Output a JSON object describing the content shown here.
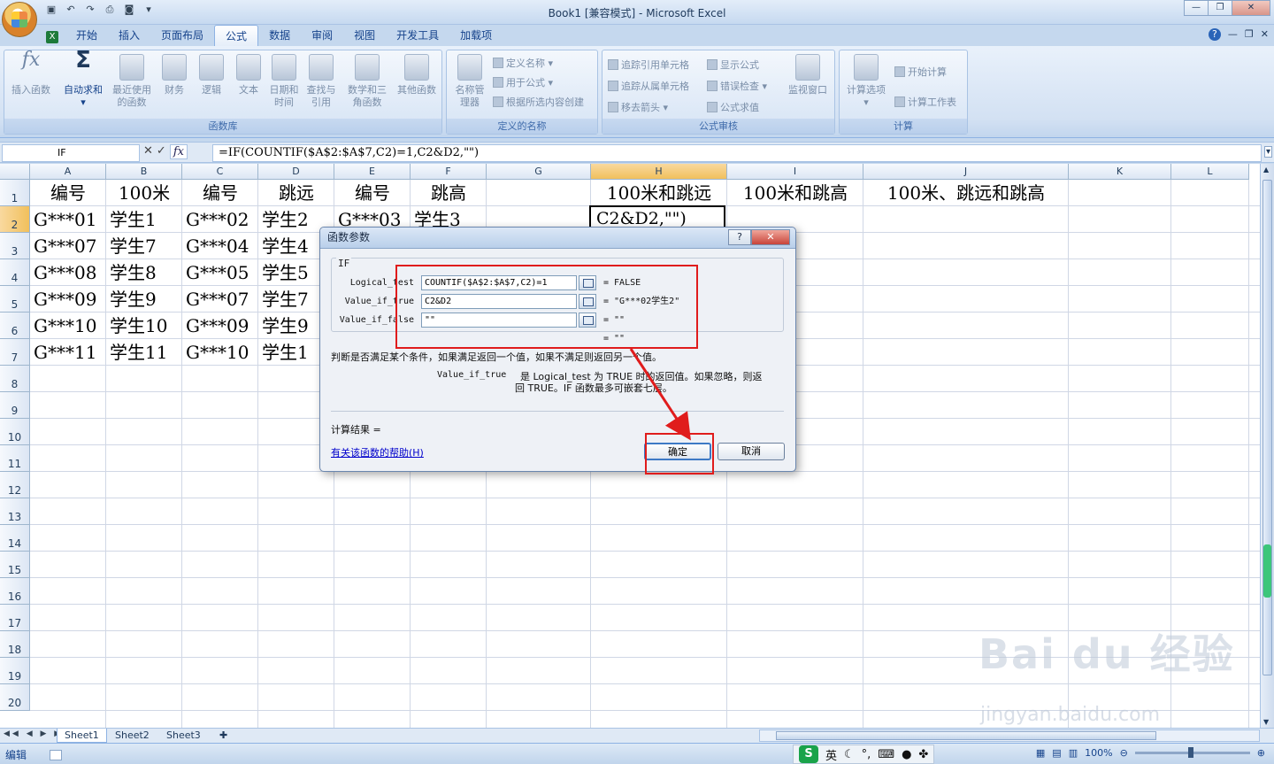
{
  "window": {
    "title": "Book1  [兼容模式] - Microsoft Excel"
  },
  "tabs": [
    "开始",
    "插入",
    "页面布局",
    "公式",
    "数据",
    "审阅",
    "视图",
    "开发工具",
    "加载项"
  ],
  "active_tab": "公式",
  "ribbon": {
    "groups": {
      "library": "函数库",
      "names": "定义的名称",
      "audit": "公式审核",
      "calc": "计算"
    },
    "buttons": {
      "insert_function": "插入函数",
      "autosum": "自动求和",
      "recent": "最近使用的函数",
      "financial": "财务",
      "logical": "逻辑",
      "text": "文本",
      "datetime": "日期和时间",
      "lookup": "查找与引用",
      "math": "数学和三角函数",
      "more": "其他函数",
      "name_manager": "名称管理器",
      "define_name": "定义名称",
      "use_in_formula": "用于公式",
      "create_from_selection": "根据所选内容创建",
      "trace_precedents": "追踪引用单元格",
      "trace_dependents": "追踪从属单元格",
      "remove_arrows": "移去箭头",
      "show_formulas": "显示公式",
      "error_checking": "错误检查",
      "evaluate_formula": "公式求值",
      "watch_window": "监视窗口",
      "calc_options": "计算选项",
      "calc_now": "开始计算",
      "calc_sheet": "计算工作表"
    }
  },
  "formula_bar": {
    "name_box": "IF",
    "formula": "=IF(COUNTIF($A$2:$A$7,C2)=1,C2&D2,\"\")"
  },
  "columns": [
    "A",
    "B",
    "C",
    "D",
    "E",
    "F",
    "G",
    "H",
    "I",
    "J",
    "K",
    "L"
  ],
  "selected_column": "H",
  "rows": [
    "1",
    "2",
    "3",
    "4",
    "5",
    "6",
    "7",
    "8",
    "9",
    "10",
    "11",
    "12",
    "13",
    "14",
    "15",
    "16",
    "17",
    "18",
    "19",
    "20"
  ],
  "selected_row": "2",
  "cells": {
    "header": [
      "编号",
      "100米",
      "编号",
      "跳远",
      "编号",
      "跳高",
      "",
      "100米和跳远",
      "100米和跳高",
      "100米、跳远和跳高"
    ],
    "data": [
      [
        "G***01",
        "学生1",
        "G***02",
        "学生2",
        "G***03",
        "学生3"
      ],
      [
        "G***07",
        "学生7",
        "G***04",
        "学生4",
        "",
        ""
      ],
      [
        "G***08",
        "学生8",
        "G***05",
        "学生5",
        "",
        ""
      ],
      [
        "G***09",
        "学生9",
        "G***07",
        "学生7",
        "",
        ""
      ],
      [
        "G***10",
        "学生10",
        "G***09",
        "学生9",
        "",
        ""
      ],
      [
        "G***11",
        "学生11",
        "G***10",
        "学生1",
        "",
        ""
      ]
    ],
    "active_cell_text": "C2&D2,\"\")"
  },
  "dialog": {
    "title": "函数参数",
    "function": "IF",
    "args": [
      {
        "label": "Logical_test",
        "value": "COUNTIF($A$2:$A$7,C2)=1",
        "result": "=  FALSE"
      },
      {
        "label": "Value_if_true",
        "value": "C2&D2",
        "result": "=  \"G***02学生2\""
      },
      {
        "label": "Value_if_false",
        "value": "\"\"",
        "result": "=  \"\""
      }
    ],
    "overall_result": "=  \"\"",
    "description": "判断是否满足某个条件，如果满足返回一个值，如果不满足则返回另一个值。",
    "arg_help_name": "Value_if_true",
    "arg_help_line1": "是 Logical_test 为 TRUE 时的返回值。如果忽略，则返",
    "arg_help_line2": "回 TRUE。IF 函数最多可嵌套七层。",
    "calc_result_label": "计算结果 =",
    "help_link": "有关该函数的帮助(H)",
    "ok": "确定",
    "cancel": "取消"
  },
  "sheets": [
    "Sheet1",
    "Sheet2",
    "Sheet3"
  ],
  "active_sheet": "Sheet1",
  "status": {
    "mode": "编辑",
    "ime_lang": "英",
    "zoom": "100%"
  },
  "watermark": {
    "line1": "Bai du 经验",
    "line2": "jingyan.baidu.com"
  },
  "colors": {
    "annotation": "#e01c1c",
    "ribbon": "#d3e1f3",
    "selected_header": "#f1c05c"
  }
}
